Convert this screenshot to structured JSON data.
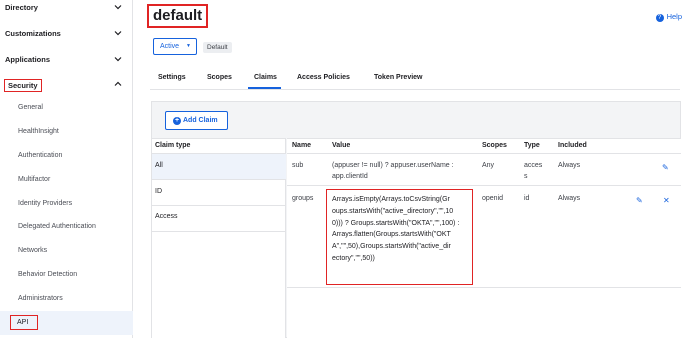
{
  "sidebar": {
    "sections": [
      {
        "label": "Directory",
        "state": "collapsed"
      },
      {
        "label": "Customizations",
        "state": "collapsed"
      },
      {
        "label": "Applications",
        "state": "collapsed"
      },
      {
        "label": "Security",
        "state": "expanded"
      }
    ],
    "security_items": [
      "General",
      "HealthInsight",
      "Authentication",
      "Multifactor",
      "Identity Providers",
      "Delegated Authentication",
      "Networks",
      "Behavior Detection",
      "Administrators",
      "API"
    ],
    "active_item": "API"
  },
  "header": {
    "title": "default",
    "help_label": "Help",
    "status_label": "Active",
    "badge": "Default"
  },
  "tabs": [
    {
      "label": "Settings"
    },
    {
      "label": "Scopes"
    },
    {
      "label": "Claims",
      "active": true
    },
    {
      "label": "Access Policies"
    },
    {
      "label": "Token Preview"
    }
  ],
  "claims": {
    "add_button_label": "Add Claim",
    "claim_type_header": "Claim type",
    "claim_types": [
      "All",
      "ID",
      "Access"
    ],
    "selected_claim_type": "All",
    "columns": [
      "Name",
      "Value",
      "Scopes",
      "Type",
      "Included"
    ],
    "rows": [
      {
        "name": "sub",
        "value_lines": [
          "(appuser != null) ? appuser.userName :",
          "app.clientId"
        ],
        "scopes": "Any",
        "type_lines": [
          "acces",
          "s"
        ],
        "included": "Always"
      },
      {
        "name": "groups",
        "value_lines": [
          "Arrays.isEmpty(Arrays.toCsvString(Gr",
          "oups.startsWith(\"active_directory\",\"\",10",
          "0))) ? Groups.startsWith(\"OKTA\",\"\",100) :",
          "Arrays.flatten(Groups.startsWith(\"OKT",
          "A\",\"\",50),Groups.startsWith(\"active_dir",
          "ectory\",\"\",50))"
        ],
        "scopes": "openid",
        "type_lines": [
          "id"
        ],
        "included": "Always"
      }
    ]
  },
  "colors": {
    "accent": "#1662dd",
    "highlight_border": "#e02424",
    "panel_bg": "#f3f4f6",
    "active_row_bg": "#eef3fb"
  }
}
